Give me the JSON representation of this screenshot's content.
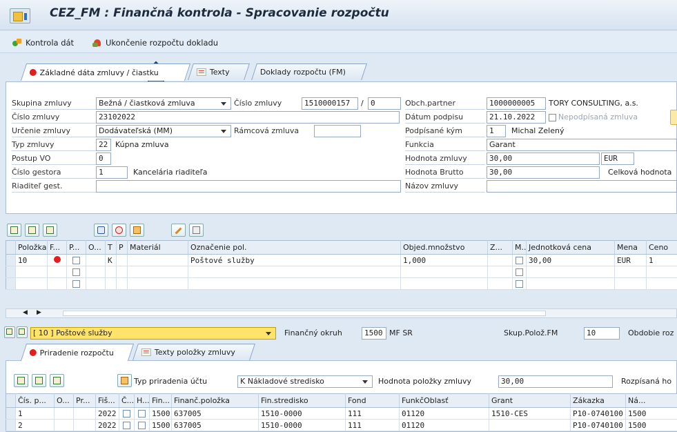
{
  "window": {
    "title": "CEZ_FM : Finančná kontrola - Spracovanie rozpočtu"
  },
  "toolbar": {
    "check_label": "Kontrola dát",
    "close_label": "Ukončenie rozpočtu dokladu"
  },
  "tabs": [
    "Základné dáta zmluvy / čiastku",
    "Texty",
    "Doklady rozpočtu (FM)"
  ],
  "header": {
    "skupina": {
      "label": "Skupina zmluvy",
      "value": "Bežná / čiastková zmluva"
    },
    "cislo_zmluvy_label": "Číslo zmluvy",
    "cislo_zmluvy_value": "1510000157",
    "cislo_zmluvy_sep": "/",
    "cislo_zmluvy_sub": "0",
    "cislo": {
      "label": "Číslo zmluvy",
      "value": "23102022"
    },
    "urcenie": {
      "label": "Určenie zmluvy",
      "value": "Dodávateľská (MM)"
    },
    "ramcova_label": "Rámcová zmluva",
    "typ": {
      "label": "Typ zmluvy",
      "code": "22",
      "text": "Kúpna zmluva"
    },
    "postup": {
      "label": "Postup VO",
      "value": "0"
    },
    "gestor": {
      "label": "Číslo gestora",
      "code": "1",
      "text": "Kancelária riaditeľa"
    },
    "riaditel": {
      "label": "Riaditeľ gest."
    },
    "partner": {
      "label": "Obch.partner",
      "code": "1000000005",
      "name": "TORY CONSULTING, a.s."
    },
    "datum": {
      "label": "Dátum podpisu",
      "value": "21.10.2022",
      "unsigned_label": "Nepodpísaná zmluva"
    },
    "podpisane": {
      "label": "Podpísané kým",
      "code": "1",
      "name": "Michal Zelený"
    },
    "funkcia": {
      "label": "Funkcia",
      "value": "Garant"
    },
    "hodnota": {
      "label": "Hodnota zmluvy",
      "value": "30,00",
      "currency": "EUR"
    },
    "brutto": {
      "label": "Hodnota Brutto",
      "value": "30,00",
      "celkova_label": "Celková hodnota"
    },
    "nazov": {
      "label": "Názov zmluvy"
    }
  },
  "items": {
    "columns": [
      "Položka",
      "F...",
      "P...",
      "O...",
      "T",
      "P",
      "Materiál",
      "Označenie pol.",
      "Objed.množstvo",
      "Z...",
      "M...",
      "Jednotková cena",
      "Mena",
      "Ceno"
    ],
    "rows": [
      {
        "polozka": "10",
        "t": "K",
        "oznacenie": "Poštové služby",
        "mnozstvo": "1,000",
        "cena": "30,00",
        "mena": "EUR",
        "ceno": "1"
      }
    ]
  },
  "item_bar": {
    "selected": "[ 10 ] Poštové služby",
    "fin_okruh_label": "Finančný okruh",
    "fin_okruh_value": "1500",
    "fin_okruh_text": "MF SR",
    "skup_label": "Skup.Polož.FM",
    "skup_value": "10",
    "obdobie_label": "Obdobie roz"
  },
  "tabs2": [
    "Priradenie rozpočtu",
    "Texty položky zmluvy"
  ],
  "assign": {
    "typ_label": "Typ priradenia účtu",
    "typ_value": "K Nákladové stredisko",
    "hodnota_label": "Hodnota položky zmluvy",
    "hodnota_value": "30,00",
    "rozpis_label": "Rozpísaná ho"
  },
  "budget": {
    "columns": [
      "Čís. p...",
      "O...",
      "Pr...",
      "Fiš...",
      "Č...",
      "H...",
      "Fin...",
      "Finanč.položka",
      "Fin.stredisko",
      "Fond",
      "FunkčOblasť",
      "Grant",
      "Zákazka",
      "Ná..."
    ],
    "rows": [
      {
        "cis": "1",
        "fis": "2022",
        "fin": "1500",
        "fpol": "637005",
        "fstr": "1510-0000",
        "fond": "111",
        "funk": "01120",
        "grant": "1510-CES",
        "zak": "P10-0740100",
        "na": "1500"
      },
      {
        "cis": "2",
        "fis": "2022",
        "fin": "1500",
        "fpol": "637005",
        "fstr": "1510-0000",
        "fond": "111",
        "funk": "01120",
        "grant": "",
        "zak": "P10-0740100",
        "na": "1500"
      }
    ]
  },
  "colors": {
    "accent": "#e21f1f",
    "annotation_arrow": "#2c73c8"
  }
}
